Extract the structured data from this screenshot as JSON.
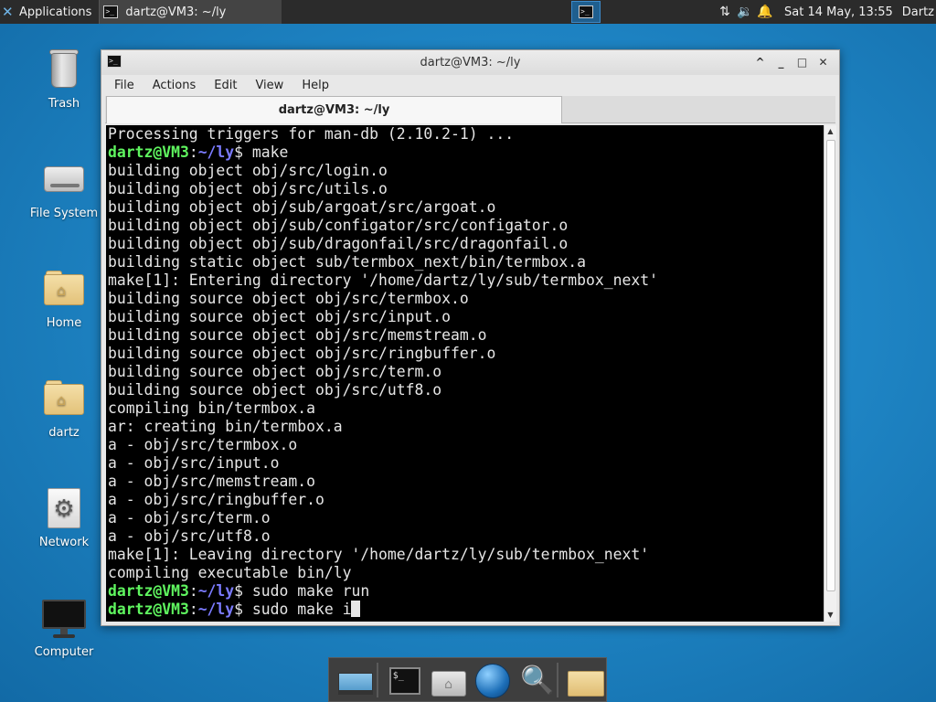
{
  "top_panel": {
    "apps_label": "Applications",
    "task_title": "dartz@VM3: ~/ly",
    "clock": "Sat 14 May, 13:55",
    "user": "Dartz",
    "tray": {
      "network_icon": "⇅",
      "volume_icon": "🔉",
      "notification_icon": "🔔"
    }
  },
  "desktop_icons": [
    {
      "label": "Trash",
      "icon": "trash-icon"
    },
    {
      "label": "File System",
      "icon": "drive-icon"
    },
    {
      "label": "Home",
      "icon": "home-folder-icon"
    },
    {
      "label": "dartz",
      "icon": "folder-icon"
    },
    {
      "label": "Network",
      "icon": "network-icon"
    },
    {
      "label": "Computer",
      "icon": "monitor-icon"
    }
  ],
  "window": {
    "title": "dartz@VM3: ~/ly",
    "menu": [
      "File",
      "Actions",
      "Edit",
      "View",
      "Help"
    ],
    "tab_label": "dartz@VM3: ~/ly",
    "controls": {
      "keep_above": "^",
      "minimize": "_",
      "maximize": "□",
      "close": "✕"
    }
  },
  "terminal": {
    "prompt": {
      "user": "dartz@VM3",
      "sep": ":",
      "path": "~/ly",
      "dollar": "$ "
    },
    "lines": [
      {
        "type": "out",
        "text": "Processing triggers for man-db (2.10.2-1) ..."
      },
      {
        "type": "cmd",
        "text": "make"
      },
      {
        "type": "out",
        "text": "building object obj/src/login.o"
      },
      {
        "type": "out",
        "text": "building object obj/src/utils.o"
      },
      {
        "type": "out",
        "text": "building object obj/sub/argoat/src/argoat.o"
      },
      {
        "type": "out",
        "text": "building object obj/sub/configator/src/configator.o"
      },
      {
        "type": "out",
        "text": "building object obj/sub/dragonfail/src/dragonfail.o"
      },
      {
        "type": "out",
        "text": "building static object sub/termbox_next/bin/termbox.a"
      },
      {
        "type": "out",
        "text": "make[1]: Entering directory '/home/dartz/ly/sub/termbox_next'"
      },
      {
        "type": "out",
        "text": "building source object obj/src/termbox.o"
      },
      {
        "type": "out",
        "text": "building source object obj/src/input.o"
      },
      {
        "type": "out",
        "text": "building source object obj/src/memstream.o"
      },
      {
        "type": "out",
        "text": "building source object obj/src/ringbuffer.o"
      },
      {
        "type": "out",
        "text": "building source object obj/src/term.o"
      },
      {
        "type": "out",
        "text": "building source object obj/src/utf8.o"
      },
      {
        "type": "out",
        "text": "compiling bin/termbox.a"
      },
      {
        "type": "out",
        "text": "ar: creating bin/termbox.a"
      },
      {
        "type": "out",
        "text": "a - obj/src/termbox.o"
      },
      {
        "type": "out",
        "text": "a - obj/src/input.o"
      },
      {
        "type": "out",
        "text": "a - obj/src/memstream.o"
      },
      {
        "type": "out",
        "text": "a - obj/src/ringbuffer.o"
      },
      {
        "type": "out",
        "text": "a - obj/src/term.o"
      },
      {
        "type": "out",
        "text": "a - obj/src/utf8.o"
      },
      {
        "type": "out",
        "text": "make[1]: Leaving directory '/home/dartz/ly/sub/termbox_next'"
      },
      {
        "type": "out",
        "text": "compiling executable bin/ly"
      },
      {
        "type": "cmd",
        "text": "sudo make run"
      },
      {
        "type": "cmd",
        "text": "sudo make i",
        "cursor": true
      }
    ]
  },
  "dock": [
    {
      "name": "show-desktop-icon"
    },
    {
      "name": "terminal-icon",
      "glyph": "$_"
    },
    {
      "name": "home-files-icon",
      "glyph": "⌂"
    },
    {
      "name": "web-browser-icon"
    },
    {
      "name": "app-finder-icon",
      "glyph": "🔍"
    },
    {
      "name": "folder-icon"
    }
  ],
  "colors": {
    "prompt_user": "#5ff55f",
    "prompt_path": "#7b7bff",
    "terminal_bg": "#000000",
    "terminal_fg": "#e6e6e6",
    "desktop_bg": "#1f86c6"
  }
}
